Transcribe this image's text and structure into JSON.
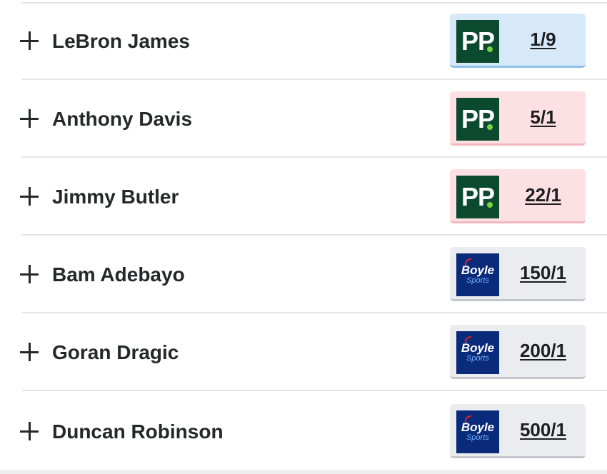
{
  "runners": [
    {
      "name": "LeBron James",
      "bookmaker": "pp-logo",
      "odds": "1/9",
      "style": "best"
    },
    {
      "name": "Anthony Davis",
      "bookmaker": "pp-logo",
      "odds": "5/1",
      "style": "pink"
    },
    {
      "name": "Jimmy Butler",
      "bookmaker": "pp-logo",
      "odds": "22/1",
      "style": "pink"
    },
    {
      "name": "Bam Adebayo",
      "bookmaker": "boylesports-logo",
      "odds": "150/1",
      "style": "grey"
    },
    {
      "name": "Goran Dragic",
      "bookmaker": "boylesports-logo",
      "odds": "200/1",
      "style": "grey"
    },
    {
      "name": "Duncan Robinson",
      "bookmaker": "boylesports-logo",
      "odds": "500/1",
      "style": "grey"
    }
  ],
  "logos": {
    "pp": "PP",
    "boyle_top": "Boyle",
    "boyle_bottom": "Sports"
  },
  "icons": {
    "expand": "plus-icon"
  },
  "colors": {
    "text": "#26272b",
    "pp_green": "#0b4a2e",
    "pp_dot": "#7bd33d",
    "boyle_navy": "#0a2a7a",
    "best_odds_bg": "#d7e9f8",
    "pink_odds_bg": "#fde0e3",
    "grey_odds_bg": "#eaecef",
    "divider": "#e6e6e6"
  }
}
